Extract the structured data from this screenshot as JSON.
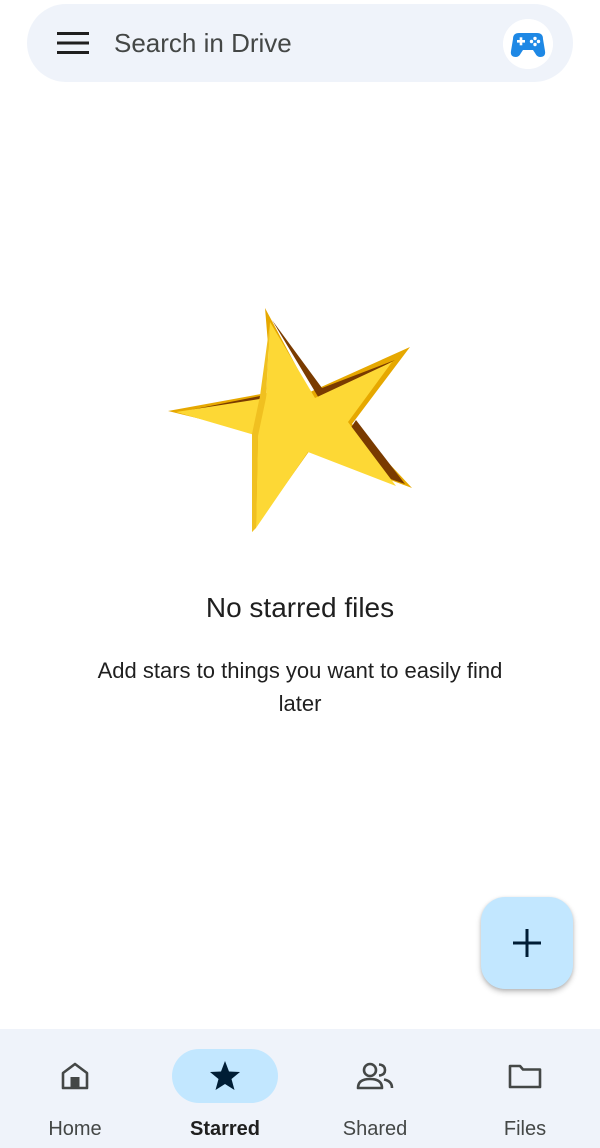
{
  "search": {
    "placeholder": "Search in Drive"
  },
  "icons": {
    "menu": "menu-icon",
    "avatar": "game-controller-avatar",
    "illustration": "gold-star-illustration",
    "fab": "plus-icon",
    "home": "home-icon",
    "starred": "star-icon",
    "shared": "people-icon",
    "files": "folder-icon"
  },
  "empty_state": {
    "title": "No starred files",
    "subtitle": "Add stars to things you want to easily find later"
  },
  "bottom_nav": {
    "items": [
      {
        "label": "Home",
        "active": false
      },
      {
        "label": "Starred",
        "active": true
      },
      {
        "label": "Shared",
        "active": false
      },
      {
        "label": "Files",
        "active": false
      }
    ]
  },
  "colors": {
    "surface": "#eff3fa",
    "accent_container": "#c2e7ff",
    "on_accent": "#001d35",
    "text_primary": "#1f1f1f",
    "text_secondary": "#444746",
    "star_gold": "#fdd835",
    "star_shade": "#e6a800",
    "star_dark": "#7a3b00",
    "avatar_blue": "#1e88e5"
  }
}
